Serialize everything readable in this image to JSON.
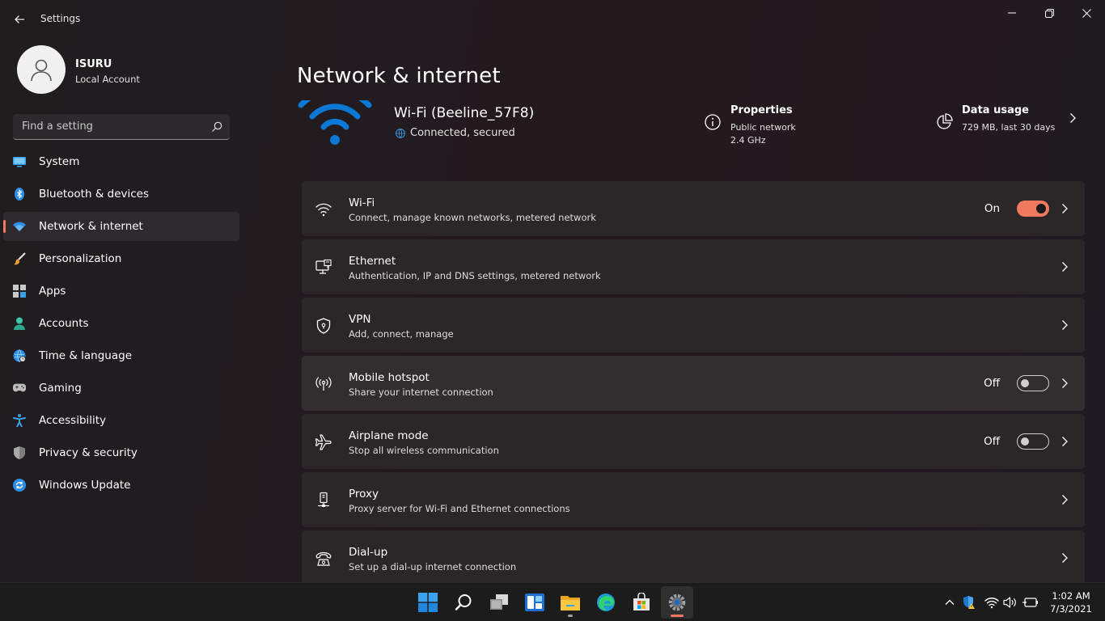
{
  "window": {
    "title": "Settings"
  },
  "user": {
    "name": "ISURU",
    "account_type": "Local Account"
  },
  "search": {
    "placeholder": "Find a setting"
  },
  "sidebar": {
    "items": [
      {
        "label": "System",
        "icon": "system-icon"
      },
      {
        "label": "Bluetooth & devices",
        "icon": "bluetooth-icon"
      },
      {
        "label": "Network & internet",
        "icon": "network-icon",
        "active": true
      },
      {
        "label": "Personalization",
        "icon": "brush-icon"
      },
      {
        "label": "Apps",
        "icon": "apps-icon"
      },
      {
        "label": "Accounts",
        "icon": "accounts-icon"
      },
      {
        "label": "Time & language",
        "icon": "globe-clock-icon"
      },
      {
        "label": "Gaming",
        "icon": "gamepad-icon"
      },
      {
        "label": "Accessibility",
        "icon": "accessibility-icon"
      },
      {
        "label": "Privacy & security",
        "icon": "shield-icon"
      },
      {
        "label": "Windows Update",
        "icon": "update-icon"
      }
    ]
  },
  "page": {
    "title": "Network & internet"
  },
  "hero": {
    "network_name": "Wi-Fi (Beeline_57F8)",
    "status": "Connected, secured",
    "properties": {
      "title": "Properties",
      "line1": "Public network",
      "line2": "2.4 GHz"
    },
    "data_usage": {
      "title": "Data usage",
      "line1": "729 MB, last 30 days"
    }
  },
  "settings": [
    {
      "title": "Wi-Fi",
      "desc": "Connect, manage known networks, metered network",
      "icon": "wifi-icon",
      "state": "On",
      "toggle": "on"
    },
    {
      "title": "Ethernet",
      "desc": "Authentication, IP and DNS settings, metered network",
      "icon": "ethernet-icon"
    },
    {
      "title": "VPN",
      "desc": "Add, connect, manage",
      "icon": "vpn-shield-icon"
    },
    {
      "title": "Mobile hotspot",
      "desc": "Share your internet connection",
      "icon": "hotspot-icon",
      "state": "Off",
      "toggle": "off"
    },
    {
      "title": "Airplane mode",
      "desc": "Stop all wireless communication",
      "icon": "airplane-icon",
      "state": "Off",
      "toggle": "off"
    },
    {
      "title": "Proxy",
      "desc": "Proxy server for Wi-Fi and Ethernet connections",
      "icon": "proxy-icon"
    },
    {
      "title": "Dial-up",
      "desc": "Set up a dial-up internet connection",
      "icon": "dialup-icon"
    }
  ],
  "taskbar": {
    "apps": [
      "start-icon",
      "search-icon",
      "task-view-icon",
      "widgets-icon",
      "file-explorer-icon",
      "edge-icon",
      "store-icon",
      "settings-icon"
    ],
    "time": "1:02 AM",
    "date": "7/3/2021"
  },
  "colors": {
    "accent": "#ef7a5f",
    "wifi_blue": "#0a78d4"
  }
}
